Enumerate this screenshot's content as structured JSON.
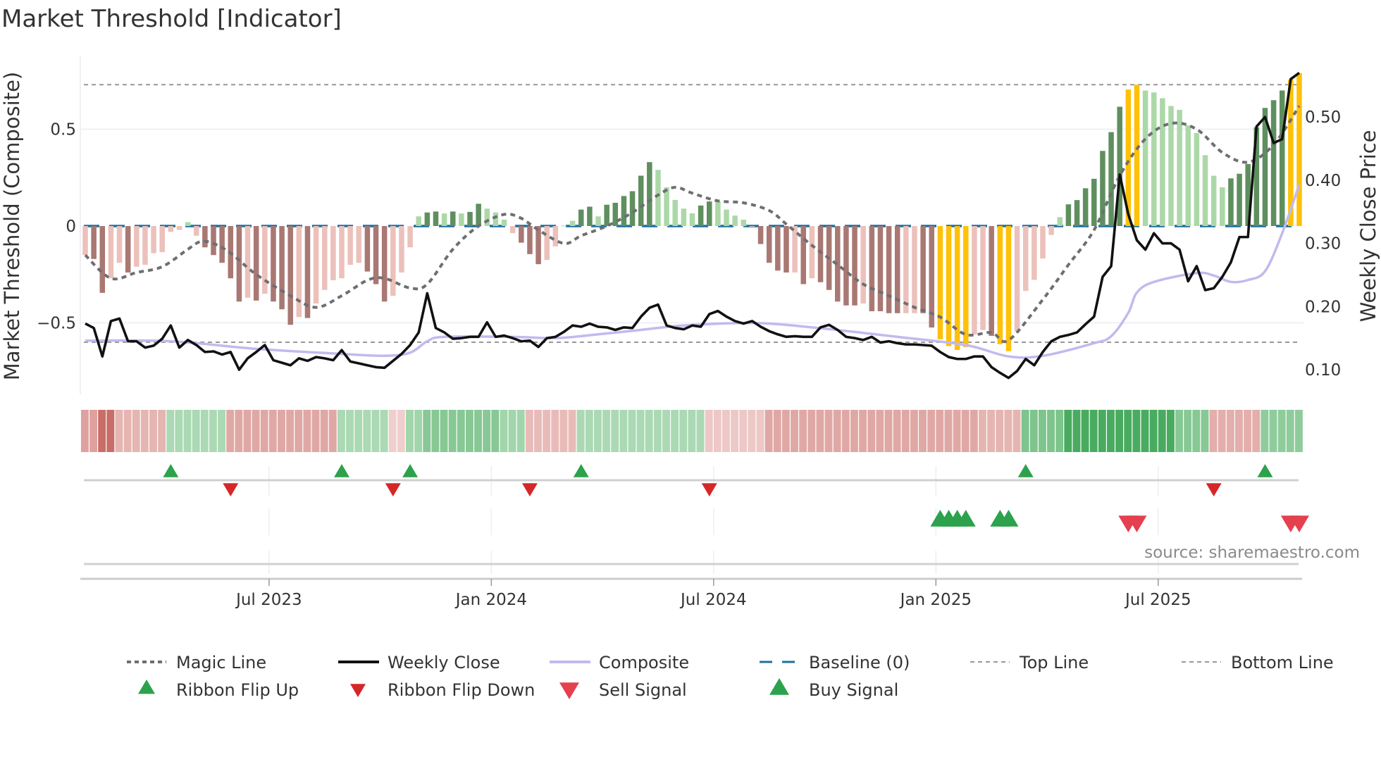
{
  "chart_data": {
    "type": "bar",
    "title": "Market Threshold [Indicator]",
    "ylabel": "Market Threshold (Composite)",
    "ylabel_right": "Weekly Close Price",
    "ylim": [
      -0.93,
      0.85
    ],
    "ylim_right": [
      0.048,
      0.6
    ],
    "yticks": [
      {
        "value": 0.5,
        "label": "0.5"
      },
      {
        "value": 0,
        "label": "0"
      },
      {
        "value": -0.5,
        "label": "−0.5"
      }
    ],
    "yticks_right": [
      {
        "value": 0.5,
        "label": "0.50"
      },
      {
        "value": 0.4,
        "label": "0.40"
      },
      {
        "value": 0.3,
        "label": "0.30"
      },
      {
        "value": 0.2,
        "label": "0.20"
      },
      {
        "value": 0.1,
        "label": "0.10"
      }
    ],
    "xticks": [
      {
        "week": 21.5,
        "label": "Jul 2023"
      },
      {
        "week": 47.5,
        "label": "Jan 2024"
      },
      {
        "week": 73.5,
        "label": "Jul 2024"
      },
      {
        "week": 99.5,
        "label": "Jan 2025"
      },
      {
        "week": 125.5,
        "label": "Jul 2025"
      }
    ],
    "grid": true,
    "top_line": 0.73,
    "bottom_line": -0.6,
    "baseline": 0,
    "bar_state_colors": {
      "S-": "#a97873",
      "W-": "#ecc1bb",
      "S+": "#5f8f5f",
      "W+": "#acd8a8",
      "X": "#ffc107"
    },
    "bars": {
      "values": [
        -0.15,
        -0.17,
        -0.345,
        -0.27,
        -0.19,
        -0.24,
        -0.21,
        -0.2,
        -0.14,
        -0.135,
        -0.03,
        -0.02,
        0.02,
        -0.05,
        -0.11,
        -0.15,
        -0.19,
        -0.27,
        -0.39,
        -0.37,
        -0.385,
        -0.35,
        -0.39,
        -0.43,
        -0.51,
        -0.47,
        -0.475,
        -0.4,
        -0.33,
        -0.28,
        -0.27,
        -0.2,
        -0.19,
        -0.235,
        -0.3,
        -0.39,
        -0.36,
        -0.24,
        -0.11,
        0.05,
        0.07,
        0.075,
        0.065,
        0.075,
        0.065,
        0.073,
        0.115,
        0.09,
        0.07,
        0.033,
        -0.037,
        -0.086,
        -0.145,
        -0.197,
        -0.175,
        -0.105,
        0.003,
        0.027,
        0.085,
        0.1,
        0.05,
        0.11,
        0.12,
        0.155,
        0.18,
        0.26,
        0.33,
        0.29,
        0.2,
        0.135,
        0.09,
        0.066,
        0.106,
        0.127,
        0.127,
        0.085,
        0.054,
        0.033,
        -0.003,
        -0.093,
        -0.19,
        -0.23,
        -0.24,
        -0.24,
        -0.3,
        -0.27,
        -0.29,
        -0.33,
        -0.39,
        -0.41,
        -0.41,
        -0.4,
        -0.44,
        -0.44,
        -0.45,
        -0.45,
        -0.45,
        -0.45,
        -0.45,
        -0.524,
        -0.585,
        -0.62,
        -0.64,
        -0.625,
        -0.56,
        -0.537,
        -0.567,
        -0.61,
        -0.646,
        -0.543,
        -0.335,
        -0.278,
        -0.168,
        -0.046,
        0.046,
        0.112,
        0.134,
        0.195,
        0.244,
        0.388,
        0.485,
        0.616,
        0.705,
        0.73,
        0.7,
        0.69,
        0.66,
        0.62,
        0.6,
        0.52,
        0.48,
        0.366,
        0.26,
        0.2,
        0.246,
        0.27,
        0.32,
        0.51,
        0.61,
        0.65,
        0.7,
        0.756,
        0.79
      ],
      "states": [
        "W-",
        "S-",
        "S-",
        "W-",
        "W-",
        "S-",
        "W-",
        "W-",
        "W-",
        "W-",
        "W-",
        "W-",
        "W+",
        "W-",
        "S-",
        "S-",
        "S-",
        "S-",
        "S-",
        "W-",
        "S-",
        "W-",
        "S-",
        "S-",
        "S-",
        "W-",
        "S-",
        "W-",
        "W-",
        "W-",
        "W-",
        "W-",
        "W-",
        "S-",
        "S-",
        "S-",
        "W-",
        "W-",
        "W-",
        "W+",
        "S+",
        "S+",
        "W+",
        "S+",
        "W+",
        "S+",
        "S+",
        "W+",
        "W+",
        "W+",
        "W-",
        "S-",
        "S-",
        "S-",
        "W-",
        "W-",
        "W+",
        "W+",
        "S+",
        "S+",
        "W+",
        "S+",
        "S+",
        "S+",
        "S+",
        "S+",
        "S+",
        "W+",
        "W+",
        "W+",
        "W+",
        "W+",
        "S+",
        "S+",
        "W+",
        "W+",
        "W+",
        "W+",
        "W-",
        "S-",
        "S-",
        "S-",
        "S-",
        "W-",
        "S-",
        "W-",
        "S-",
        "S-",
        "S-",
        "S-",
        "S-",
        "W-",
        "S-",
        "S-",
        "S-",
        "S-",
        "W-",
        "W-",
        "S-",
        "S-",
        "X",
        "X",
        "X",
        "X",
        "W-",
        "W-",
        "S-",
        "X",
        "X",
        "W-",
        "W-",
        "W-",
        "W-",
        "W-",
        "W+",
        "S+",
        "S+",
        "S+",
        "S+",
        "S+",
        "S+",
        "S+",
        "X",
        "X",
        "W+",
        "W+",
        "W+",
        "W+",
        "W+",
        "W+",
        "W+",
        "W+",
        "W+",
        "W+",
        "S+",
        "S+",
        "S+",
        "S+",
        "S+",
        "S+",
        "S+",
        "X",
        "X"
      ]
    },
    "series": [
      {
        "name": "Weekly Close",
        "axis": "right",
        "color": "#111111",
        "values": [
          0.173,
          0.166,
          0.121,
          0.177,
          0.181,
          0.145,
          0.145,
          0.135,
          0.138,
          0.149,
          0.17,
          0.135,
          0.147,
          0.139,
          0.128,
          0.129,
          0.124,
          0.128,
          0.1,
          0.118,
          0.128,
          0.139,
          0.115,
          0.111,
          0.107,
          0.118,
          0.114,
          0.12,
          0.118,
          0.115,
          0.131,
          0.113,
          0.11,
          0.107,
          0.104,
          0.103,
          0.114,
          0.125,
          0.139,
          0.159,
          0.221,
          0.166,
          0.159,
          0.149,
          0.15,
          0.152,
          0.152,
          0.175,
          0.152,
          0.154,
          0.15,
          0.145,
          0.146,
          0.136,
          0.15,
          0.152,
          0.16,
          0.17,
          0.168,
          0.173,
          0.168,
          0.167,
          0.163,
          0.167,
          0.166,
          0.184,
          0.198,
          0.203,
          0.17,
          0.166,
          0.164,
          0.17,
          0.168,
          0.188,
          0.193,
          0.184,
          0.177,
          0.173,
          0.177,
          0.168,
          0.161,
          0.156,
          0.152,
          0.153,
          0.152,
          0.152,
          0.167,
          0.171,
          0.163,
          0.152,
          0.15,
          0.147,
          0.152,
          0.143,
          0.145,
          0.142,
          0.14,
          0.14,
          0.139,
          0.138,
          0.128,
          0.12,
          0.117,
          0.117,
          0.121,
          0.121,
          0.104,
          0.095,
          0.087,
          0.098,
          0.117,
          0.107,
          0.128,
          0.145,
          0.152,
          0.155,
          0.159,
          0.172,
          0.184,
          0.247,
          0.264,
          0.409,
          0.346,
          0.305,
          0.29,
          0.316,
          0.3,
          0.3,
          0.29,
          0.24,
          0.264,
          0.226,
          0.229,
          0.247,
          0.27,
          0.31,
          0.31,
          0.485,
          0.5,
          0.459,
          0.465,
          0.56,
          0.57
        ]
      },
      {
        "name": "Magic Line",
        "axis": "left",
        "color": "#6e6e73",
        "points": [
          [
            0,
            -0.15
          ],
          [
            3,
            -0.27
          ],
          [
            6,
            -0.24
          ],
          [
            9,
            -0.21
          ],
          [
            12,
            -0.12
          ],
          [
            13.5,
            -0.08
          ],
          [
            15,
            -0.09
          ],
          [
            17,
            -0.14
          ],
          [
            20,
            -0.25
          ],
          [
            24,
            -0.36
          ],
          [
            27,
            -0.42
          ],
          [
            30,
            -0.36
          ],
          [
            33,
            -0.28
          ],
          [
            35,
            -0.27
          ],
          [
            38,
            -0.32
          ],
          [
            40,
            -0.3
          ],
          [
            43,
            -0.12
          ],
          [
            46,
            0.0
          ],
          [
            49,
            0.06
          ],
          [
            51,
            0.04
          ],
          [
            53,
            -0.02
          ],
          [
            56,
            -0.09
          ],
          [
            58,
            -0.05
          ],
          [
            61,
            0.0
          ],
          [
            64,
            0.07
          ],
          [
            67,
            0.16
          ],
          [
            69,
            0.2
          ],
          [
            71,
            0.17
          ],
          [
            74,
            0.13
          ],
          [
            77,
            0.12
          ],
          [
            80,
            0.08
          ],
          [
            82,
            0.01
          ],
          [
            85,
            -0.1
          ],
          [
            88,
            -0.2
          ],
          [
            91,
            -0.3
          ],
          [
            94,
            -0.36
          ],
          [
            97,
            -0.42
          ],
          [
            100,
            -0.47
          ],
          [
            103,
            -0.56
          ],
          [
            106,
            -0.55
          ],
          [
            108,
            -0.59
          ],
          [
            112,
            -0.38
          ],
          [
            115,
            -0.2
          ],
          [
            118,
            -0.02
          ],
          [
            121,
            0.26
          ],
          [
            124,
            0.45
          ],
          [
            127,
            0.53
          ],
          [
            130,
            0.5
          ],
          [
            133,
            0.38
          ],
          [
            136,
            0.33
          ],
          [
            139,
            0.42
          ],
          [
            142,
            0.62
          ]
        ]
      },
      {
        "name": "Composite",
        "axis": "right",
        "color": "#c3b9ee",
        "points": [
          [
            0,
            0.146
          ],
          [
            10,
            0.145
          ],
          [
            20,
            0.133
          ],
          [
            30,
            0.125
          ],
          [
            35,
            0.122
          ],
          [
            38,
            0.127
          ],
          [
            40,
            0.145
          ],
          [
            42,
            0.152
          ],
          [
            50,
            0.152
          ],
          [
            55,
            0.15
          ],
          [
            60,
            0.156
          ],
          [
            65,
            0.163
          ],
          [
            70,
            0.17
          ],
          [
            78,
            0.174
          ],
          [
            85,
            0.167
          ],
          [
            95,
            0.152
          ],
          [
            103,
            0.139
          ],
          [
            108,
            0.121
          ],
          [
            112,
            0.122
          ],
          [
            118,
            0.142
          ],
          [
            120,
            0.153
          ],
          [
            122,
            0.19
          ],
          [
            123,
            0.222
          ],
          [
            125,
            0.239
          ],
          [
            130,
            0.253
          ],
          [
            132,
            0.249
          ],
          [
            134,
            0.239
          ],
          [
            136,
            0.242
          ],
          [
            138,
            0.256
          ],
          [
            140,
            0.316
          ],
          [
            142,
            0.393
          ]
        ]
      }
    ],
    "ribbon_segments": [
      {
        "start": 0,
        "end": 1,
        "state": "down",
        "strength": 0.5
      },
      {
        "start": 2,
        "end": 3,
        "state": "down",
        "strength": 0.9
      },
      {
        "start": 4,
        "end": 9,
        "state": "down",
        "strength": 0.35
      },
      {
        "start": 10,
        "end": 16,
        "state": "up",
        "strength": 0.3
      },
      {
        "start": 17,
        "end": 29,
        "state": "down",
        "strength": 0.45
      },
      {
        "start": 30,
        "end": 35,
        "state": "up",
        "strength": 0.3
      },
      {
        "start": 36,
        "end": 37,
        "state": "down",
        "strength": 0.15
      },
      {
        "start": 38,
        "end": 39,
        "state": "up",
        "strength": 0.35
      },
      {
        "start": 40,
        "end": 48,
        "state": "up",
        "strength": 0.5
      },
      {
        "start": 49,
        "end": 51,
        "state": "up",
        "strength": 0.35
      },
      {
        "start": 52,
        "end": 57,
        "state": "down",
        "strength": 0.3
      },
      {
        "start": 58,
        "end": 72,
        "state": "up",
        "strength": 0.3
      },
      {
        "start": 73,
        "end": 79,
        "state": "down",
        "strength": 0.2
      },
      {
        "start": 80,
        "end": 104,
        "state": "down",
        "strength": 0.45
      },
      {
        "start": 105,
        "end": 109,
        "state": "down",
        "strength": 0.35
      },
      {
        "start": 110,
        "end": 114,
        "state": "up",
        "strength": 0.55
      },
      {
        "start": 115,
        "end": 127,
        "state": "up",
        "strength": 0.85
      },
      {
        "start": 128,
        "end": 131,
        "state": "up",
        "strength": 0.5
      },
      {
        "start": 132,
        "end": 137,
        "state": "down",
        "strength": 0.4
      },
      {
        "start": 138,
        "end": 142,
        "state": "up",
        "strength": 0.45
      }
    ],
    "ribbon_flip_up": [
      10,
      30,
      38,
      58,
      110,
      138
    ],
    "ribbon_flip_down": [
      17,
      36,
      52,
      73,
      132
    ],
    "buy_signals": [
      100,
      101,
      102,
      103,
      107,
      108
    ],
    "sell_signals": [
      122,
      123,
      141,
      142
    ],
    "legend": {
      "placement": "bottom",
      "items": [
        {
          "label": "Magic Line",
          "kind": "dotted",
          "color": "#6e6e73"
        },
        {
          "label": "Weekly Close",
          "kind": "solid",
          "color": "#111111"
        },
        {
          "label": "Composite",
          "kind": "solid",
          "color": "#c3b9ee"
        },
        {
          "label": "Baseline (0)",
          "kind": "dashed",
          "color": "#1f6f9f"
        },
        {
          "label": "Top Line",
          "kind": "thin-dashed",
          "color": "#999999"
        },
        {
          "label": "Bottom Line",
          "kind": "thin-dashed",
          "color": "#999999"
        },
        {
          "label": "Ribbon Flip Up",
          "kind": "tri-up",
          "color": "#2ca24c"
        },
        {
          "label": "Ribbon Flip Down",
          "kind": "tri-down",
          "color": "#d62728"
        },
        {
          "label": "Sell Signal",
          "kind": "tri-down-big",
          "color": "#e5404f"
        },
        {
          "label": "Buy Signal",
          "kind": "tri-up-big",
          "color": "#2ca24c"
        }
      ]
    },
    "source": "source: sharemaestro.com"
  }
}
